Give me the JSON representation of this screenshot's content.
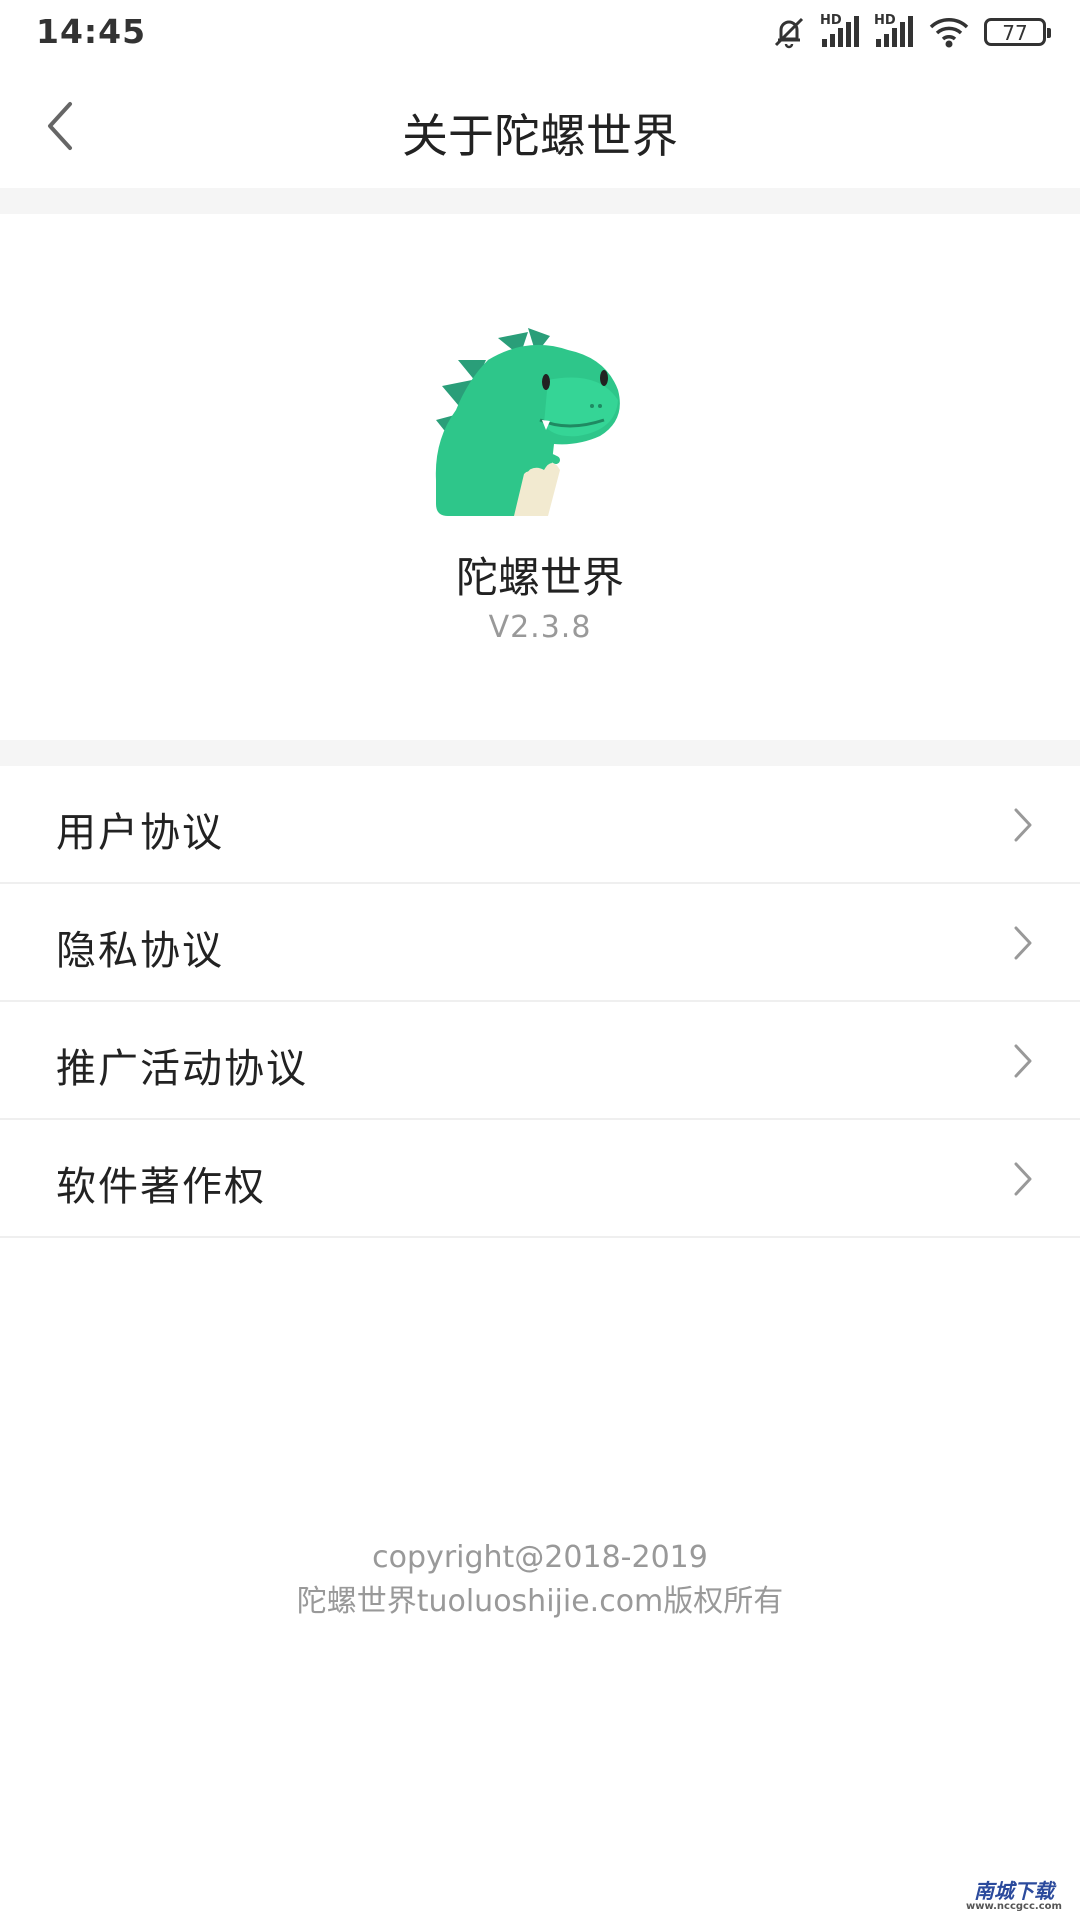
{
  "status_bar": {
    "time": "14:45",
    "battery": "77",
    "icons": [
      "mute-bell-icon",
      "hd-signal-icon",
      "hd-signal-icon",
      "wifi-icon",
      "battery-icon"
    ],
    "hd_label": "HD"
  },
  "header": {
    "title": "关于陀螺世界",
    "back_icon": "chevron-left-icon"
  },
  "app": {
    "name": "陀螺世界",
    "version": "V2.3.8",
    "logo_icon": "dinosaur-logo-icon",
    "accent": "#2ec68a"
  },
  "menu": {
    "items": [
      {
        "label": "用户协议"
      },
      {
        "label": "隐私协议"
      },
      {
        "label": "推广活动协议"
      },
      {
        "label": "软件著作权"
      }
    ],
    "chevron_icon": "chevron-right-icon"
  },
  "footer": {
    "line1": "copyright@2018-2019",
    "line2": "陀螺世界tuoluoshijie.com版权所有"
  },
  "watermark": {
    "title": "南城下载",
    "url": "www.nccgcc.com"
  }
}
